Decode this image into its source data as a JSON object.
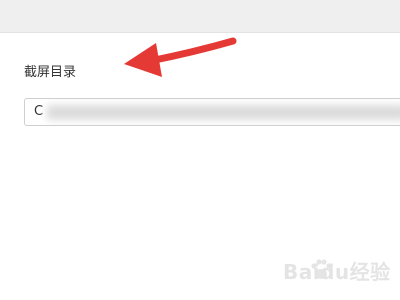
{
  "screenshot_dir": {
    "label": "截屏目录",
    "path_value": "C"
  },
  "annotation": {
    "arrow_color": "#e53935"
  },
  "watermark": {
    "text": "Baidu经验",
    "icon": "baidu-paw-icon"
  }
}
